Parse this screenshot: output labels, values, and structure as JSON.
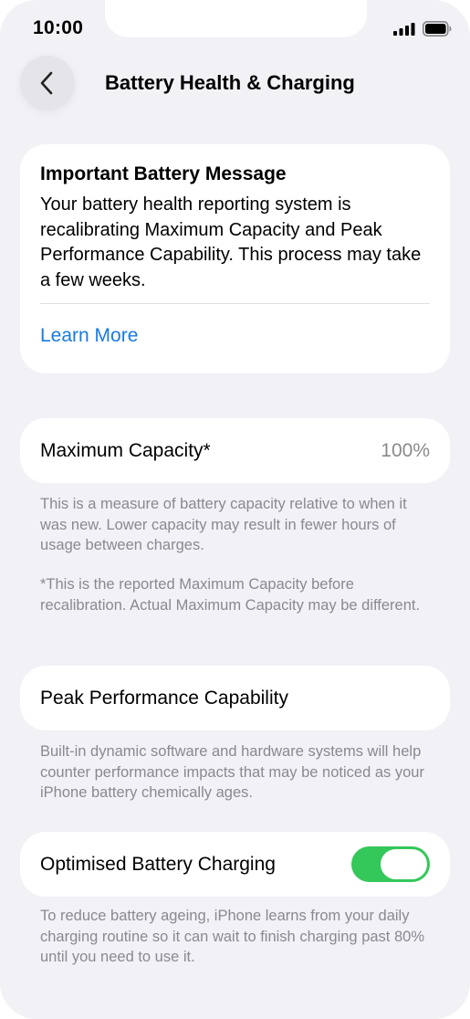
{
  "status_bar": {
    "time": "10:00",
    "icons": [
      "signal-icon",
      "battery-icon"
    ]
  },
  "nav": {
    "back_icon": "chevron-left-icon",
    "title": "Battery Health & Charging"
  },
  "message_card": {
    "title": "Important Battery Message",
    "body": "Your battery health reporting system is recalibrating Maximum Capacity and Peak Performance Capability. This process may take a few weeks.",
    "link_label": "Learn More"
  },
  "capacity": {
    "label": "Maximum Capacity*",
    "value": "100%",
    "note_1": "This is a measure of battery capacity relative to when it was new. Lower capacity may result in fewer hours of usage between charges.",
    "note_2": "*This is the reported Maximum Capacity before recalibration. Actual Maximum Capacity may be different."
  },
  "peak": {
    "label": "Peak Performance Capability",
    "note": "Built-in dynamic software and hardware systems will help counter performance impacts that may be noticed as your iPhone battery chemically ages."
  },
  "charging": {
    "label": "Optimised Battery Charging",
    "enabled": true,
    "note": "To reduce battery ageing, iPhone learns from your daily charging routine so it can wait to finish charging past 80% until you need to use it."
  },
  "colors": {
    "background": "#f1f1f6",
    "card": "#ffffff",
    "link": "#1a7be0",
    "secondary_text": "#8a8a8e",
    "toggle_on": "#34c759"
  }
}
